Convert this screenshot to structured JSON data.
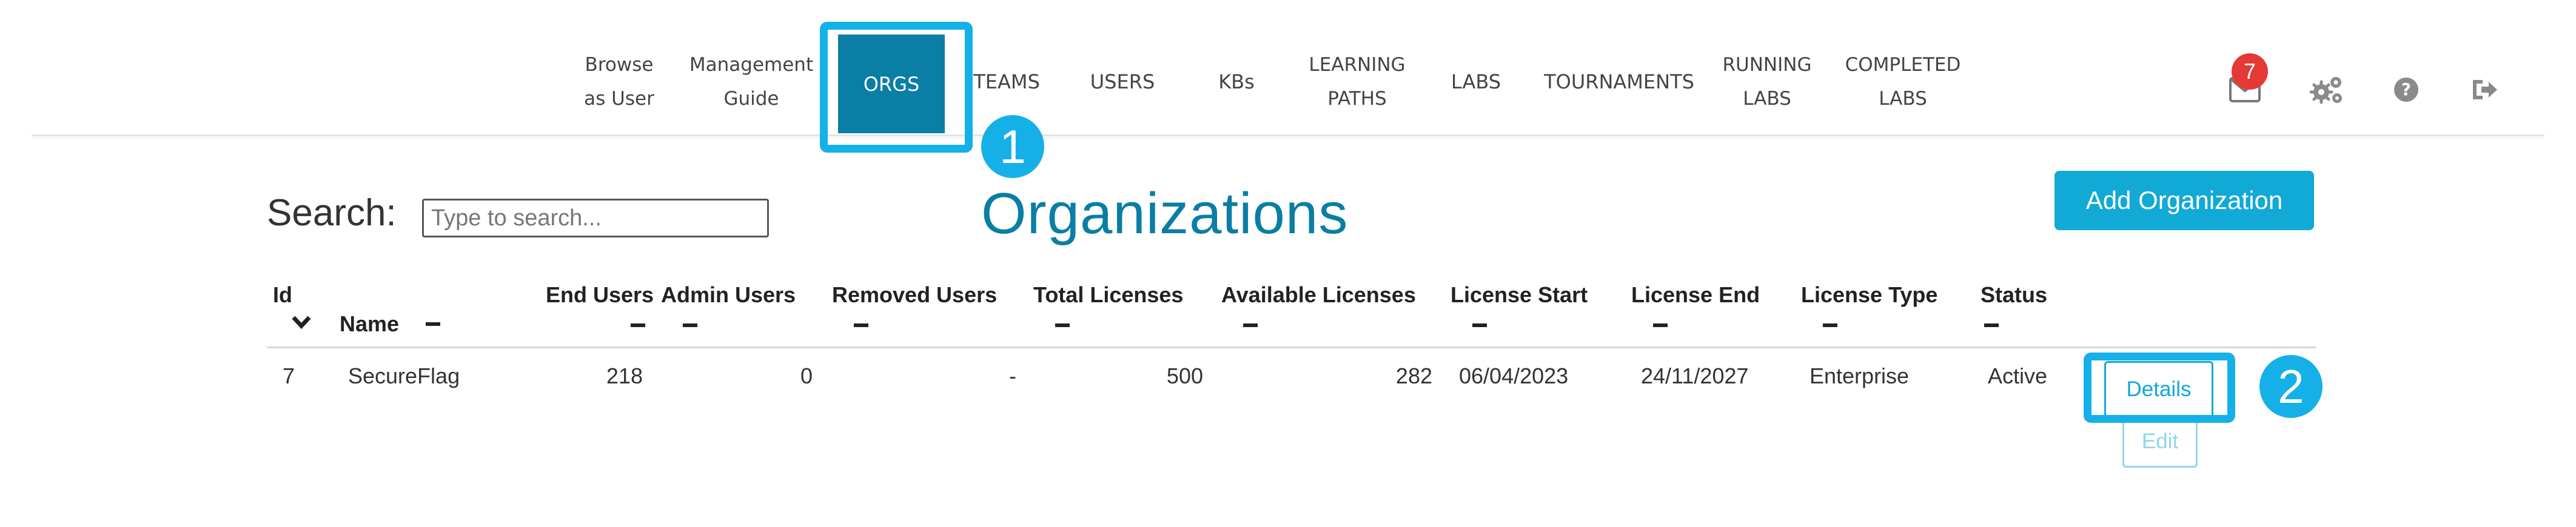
{
  "nav": {
    "items": [
      {
        "label": "Browse\nas User",
        "active": false
      },
      {
        "label": "Management\nGuide",
        "active": false
      },
      {
        "label": "ORGS",
        "active": true
      },
      {
        "label": "TEAMS",
        "active": false
      },
      {
        "label": "USERS",
        "active": false
      },
      {
        "label": "KBs",
        "active": false
      },
      {
        "label": "LEARNING\nPATHS",
        "active": false
      },
      {
        "label": "LABS",
        "active": false
      },
      {
        "label": "TOURNAMENTS",
        "active": false
      },
      {
        "label": "RUNNING\nLABS",
        "active": false
      },
      {
        "label": "COMPLETED\nLABS",
        "active": false
      }
    ],
    "icons": [
      "mail-icon",
      "gears-icon",
      "help-icon",
      "logout-icon"
    ],
    "notification_count": "7"
  },
  "annotations": {
    "marker_1": "1",
    "marker_2": "2"
  },
  "search": {
    "label": "Search:",
    "placeholder": "Type to search..."
  },
  "page": {
    "title": "Organizations",
    "add_button": "Add Organization"
  },
  "table": {
    "columns": [
      "Id",
      "Name",
      "End Users",
      "Admin Users",
      "Removed Users",
      "Total Licenses",
      "Available Licenses",
      "License Start",
      "License End",
      "License Type",
      "Status"
    ],
    "rows": [
      {
        "id": "7",
        "name": "SecureFlag",
        "end_users": "218",
        "admin_users": "0",
        "removed_users": "-",
        "total_licenses": "500",
        "available_licenses": "282",
        "license_start": "06/04/2023",
        "license_end": "24/11/2027",
        "license_type": "Enterprise",
        "status": "Active",
        "actions": [
          "Details",
          "Edit"
        ]
      }
    ]
  },
  "colors": {
    "accent": "#0a7ea4",
    "highlight": "#16b0e8",
    "button": "#11a9d6",
    "badge": "#e53935"
  }
}
